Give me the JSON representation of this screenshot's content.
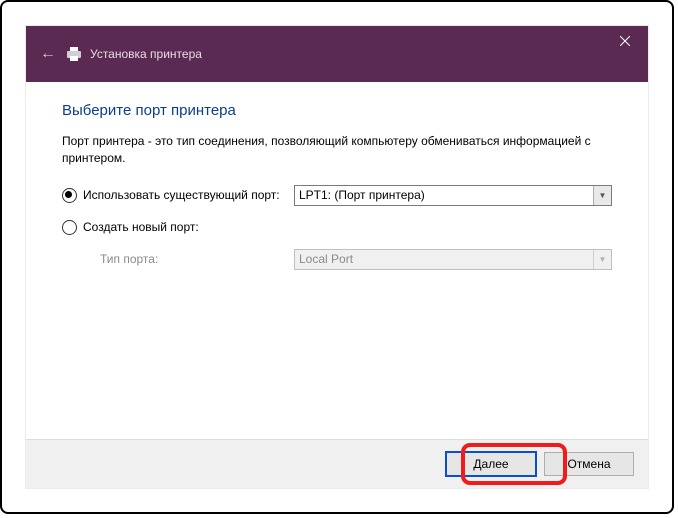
{
  "titlebar": {
    "title": "Установка принтера"
  },
  "content": {
    "heading": "Выберите порт принтера",
    "description": "Порт принтера - это тип соединения, позволяющий компьютеру обмениваться информацией с принтером.",
    "option_existing": "Использовать существующий порт:",
    "option_new": "Создать новый порт:",
    "port_type_label": "Тип порта:",
    "existing_port_value": "LPT1: (Порт принтера)",
    "new_port_value": "Local Port"
  },
  "footer": {
    "next": "Далее",
    "cancel": "Отмена"
  }
}
